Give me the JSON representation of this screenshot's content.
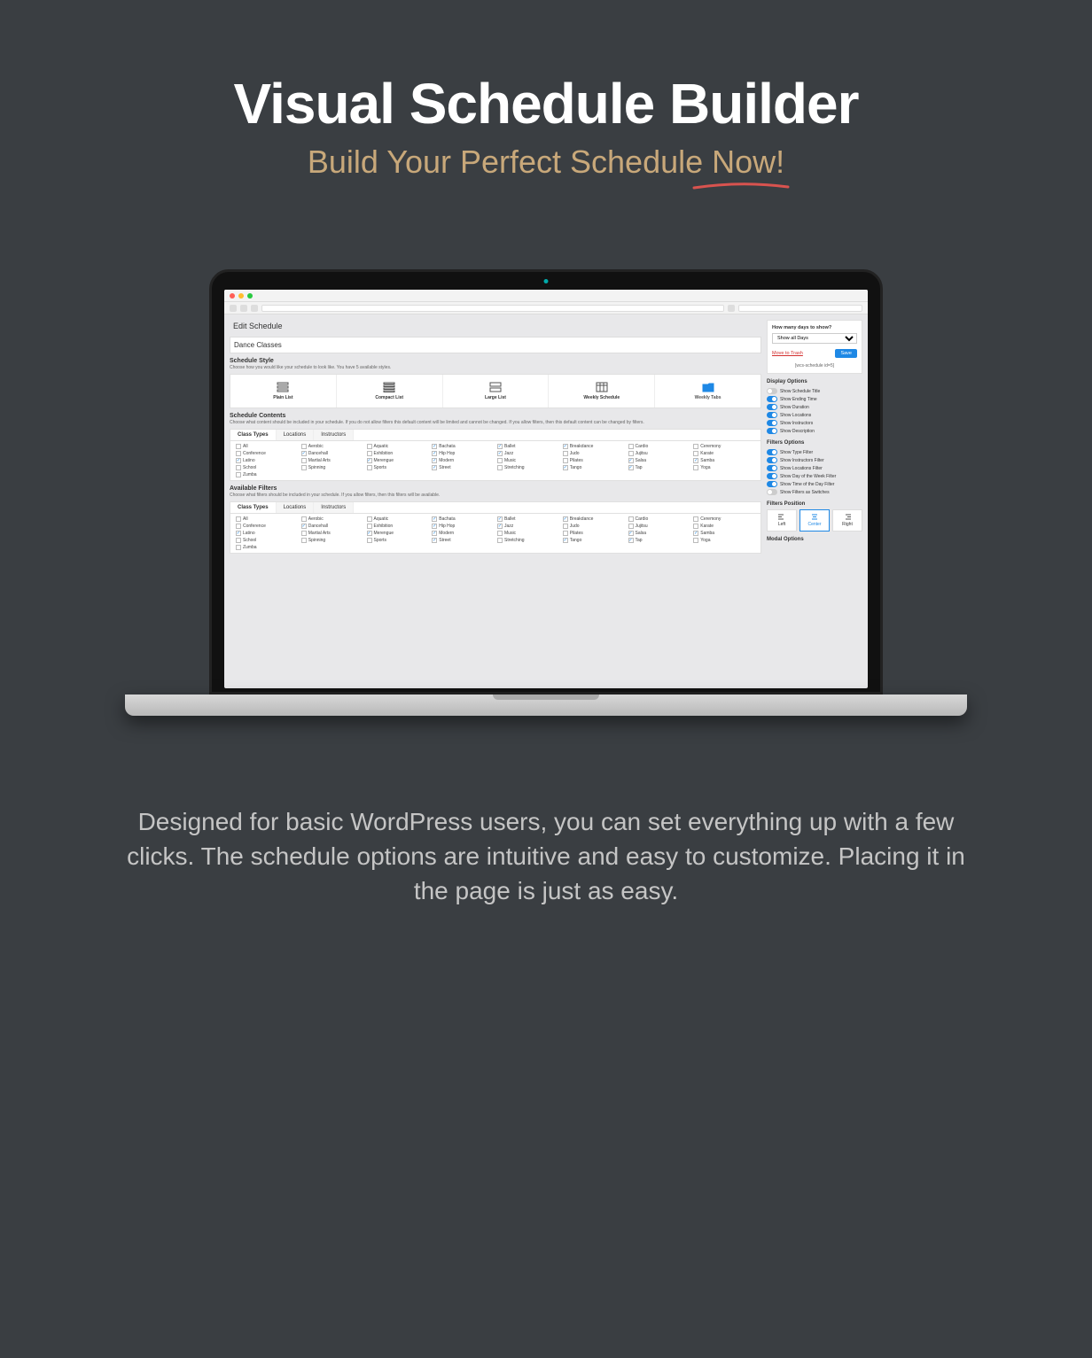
{
  "hero": {
    "title": "Visual Schedule Builder",
    "subtitle": "Build Your Perfect Schedule Now!"
  },
  "bottom_text": "Designed for basic WordPress users, you can set everything up with a few clicks. The schedule options are intuitive and easy to customize. Placing it in the page is just as easy.",
  "app": {
    "page_title": "Edit Schedule",
    "schedule_name": "Dance Classes",
    "style_section": {
      "title": "Schedule Style",
      "desc": "Choose how you would like your schedule to look like. You have 5 available styles."
    },
    "style_options": [
      {
        "label": "Plain List",
        "active": false
      },
      {
        "label": "Compact List",
        "active": false
      },
      {
        "label": "Large List",
        "active": false
      },
      {
        "label": "Weekly Schedule",
        "active": false
      },
      {
        "label": "Weekly Tabs",
        "active": true
      }
    ],
    "contents_section": {
      "title": "Schedule Contents",
      "desc": "Choose what content should be included in your schedule. If you do not allow filters this default content will be limited and cannot be changed. If you allow filters, then this default content can be changed by filters."
    },
    "filters_section": {
      "title": "Available Filters",
      "desc": "Choose what filters should be included in your schedule. If you allow filters, then this filters will be available."
    },
    "tabs": [
      "Class Types",
      "Locations",
      "Instructors"
    ],
    "class_types": [
      {
        "label": "All",
        "on": false
      },
      {
        "label": "Aerobic",
        "on": false
      },
      {
        "label": "Aquatic",
        "on": false
      },
      {
        "label": "Bachata",
        "on": true
      },
      {
        "label": "Ballet",
        "on": true
      },
      {
        "label": "Breakdance",
        "on": true
      },
      {
        "label": "Cardio",
        "on": false
      },
      {
        "label": "Ceremony",
        "on": false
      },
      {
        "label": "Conference",
        "on": false
      },
      {
        "label": "Dancehall",
        "on": true
      },
      {
        "label": "Exhibition",
        "on": false
      },
      {
        "label": "Hip Hop",
        "on": true
      },
      {
        "label": "Jazz",
        "on": true
      },
      {
        "label": "Judo",
        "on": false
      },
      {
        "label": "Jujitsu",
        "on": false
      },
      {
        "label": "Karate",
        "on": false
      },
      {
        "label": "Latino",
        "on": true
      },
      {
        "label": "Martial Arts",
        "on": false
      },
      {
        "label": "Merengue",
        "on": true
      },
      {
        "label": "Modern",
        "on": true
      },
      {
        "label": "Music",
        "on": false
      },
      {
        "label": "Pilates",
        "on": false
      },
      {
        "label": "Salsa",
        "on": true
      },
      {
        "label": "Samba",
        "on": true
      },
      {
        "label": "School",
        "on": false
      },
      {
        "label": "Spinning",
        "on": false
      },
      {
        "label": "Sports",
        "on": false
      },
      {
        "label": "Street",
        "on": true
      },
      {
        "label": "Stretching",
        "on": false
      },
      {
        "label": "Tango",
        "on": true
      },
      {
        "label": "Tap",
        "on": true
      },
      {
        "label": "Yoga",
        "on": false
      },
      {
        "label": "Zumba",
        "on": false
      }
    ],
    "publish": {
      "days_label": "How many days to show?",
      "days_value": "Show all Days",
      "trash": "Move to Trash",
      "save": "Save",
      "shortcode": "[wcs-schedule id=5]"
    },
    "display_options": {
      "title": "Display Options",
      "items": [
        {
          "label": "Show Schedule Title",
          "on": false
        },
        {
          "label": "Show Ending Time",
          "on": true
        },
        {
          "label": "Show Duration",
          "on": true
        },
        {
          "label": "Show Locations",
          "on": true
        },
        {
          "label": "Show Instructors",
          "on": true
        },
        {
          "label": "Show Description",
          "on": true
        }
      ]
    },
    "filters_options": {
      "title": "Filters Options",
      "items": [
        {
          "label": "Show Type Filter",
          "on": true
        },
        {
          "label": "Show Instructors Filter",
          "on": true
        },
        {
          "label": "Show Locations Filter",
          "on": true
        },
        {
          "label": "Show Day of the Week Filter",
          "on": true
        },
        {
          "label": "Show Time of the Day Filter",
          "on": true
        },
        {
          "label": "Show Filters as Switches",
          "on": false
        }
      ]
    },
    "filters_position": {
      "title": "Filters Position",
      "options": [
        {
          "label": "Left",
          "active": false
        },
        {
          "label": "Center",
          "active": true
        },
        {
          "label": "Right",
          "active": false
        }
      ]
    },
    "modal_options": {
      "title": "Modal Options"
    }
  }
}
